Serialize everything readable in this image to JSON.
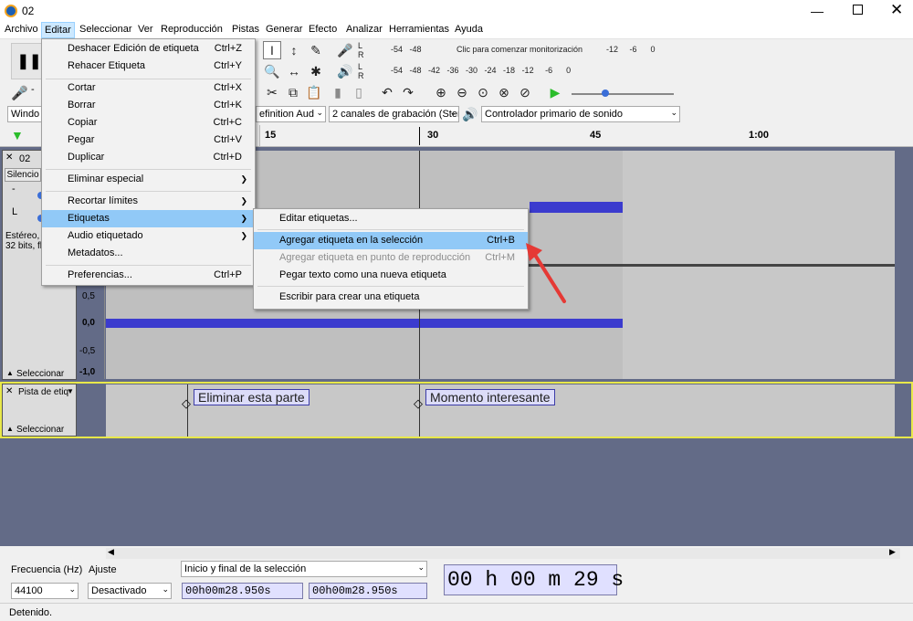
{
  "window": {
    "title": "02"
  },
  "menubar": [
    "Archivo",
    "Editar",
    "Seleccionar",
    "Ver",
    "Reproducción",
    "Pistas",
    "Generar",
    "Efecto",
    "Analizar",
    "Herramientas",
    "Ayuda"
  ],
  "meters": {
    "rec_scale": "-54   -48   ",
    "rec_prompt": "Clic para comenzar monitorización",
    "rec_scale_end": "-12     -6      0",
    "play_scale": "-54   -48   -42   -36   -30   -24   -18   -12     -6      0",
    "L": "L",
    "R": "R"
  },
  "devices": {
    "host": "Windo",
    "input": "efinition Aud",
    "channels": "2 canales de grabación (Ster",
    "output": "Controlador primario de sonido"
  },
  "ruler": {
    "t15": "15",
    "t30": "30",
    "t45": "45",
    "t100": "1:00"
  },
  "track1": {
    "name": "02",
    "mute": "Silencio",
    "info": "Estéreo, 4",
    "info2": "32 bits, flo",
    "select": "Seleccionar",
    "scale": [
      "0,5",
      "0,0",
      "-0,5",
      "-1,0"
    ],
    "L": "L",
    "minus": "-"
  },
  "track2": {
    "name": "Pista de etiq",
    "select": "Seleccionar",
    "labels": [
      "Eliminar esta parte",
      "Momento interesante"
    ]
  },
  "edit_menu": [
    {
      "label": "Deshacer Edición de etiqueta",
      "shortcut": "Ctrl+Z"
    },
    {
      "label": "Rehacer Etiqueta",
      "shortcut": "Ctrl+Y"
    },
    {
      "label": "Cortar",
      "shortcut": "Ctrl+X"
    },
    {
      "label": "Borrar",
      "shortcut": "Ctrl+K"
    },
    {
      "label": "Copiar",
      "shortcut": "Ctrl+C"
    },
    {
      "label": "Pegar",
      "shortcut": "Ctrl+V"
    },
    {
      "label": "Duplicar",
      "shortcut": "Ctrl+D"
    },
    {
      "label": "Eliminar especial",
      "shortcut": ""
    },
    {
      "label": "Recortar límites",
      "shortcut": ""
    },
    {
      "label": "Etiquetas",
      "shortcut": ""
    },
    {
      "label": "Audio etiquetado",
      "shortcut": ""
    },
    {
      "label": "Metadatos...",
      "shortcut": ""
    },
    {
      "label": "Preferencias...",
      "shortcut": "Ctrl+P"
    }
  ],
  "labels_menu": [
    {
      "label": "Editar etiquetas...",
      "shortcut": ""
    },
    {
      "label": "Agregar etiqueta en la selección",
      "shortcut": "Ctrl+B"
    },
    {
      "label": "Agregar etiqueta en punto de reproducción",
      "shortcut": "Ctrl+M"
    },
    {
      "label": "Pegar texto como una nueva etiqueta",
      "shortcut": ""
    },
    {
      "label": "Escribir para crear una etiqueta",
      "shortcut": ""
    }
  ],
  "bottom": {
    "rate_label": "Frecuencia (Hz)",
    "rate_value": "44100",
    "snap_label": "Ajuste",
    "snap_value": "Desactivado",
    "sel_mode": "Inicio y final de la selección",
    "sel_start": "00h00m28.950s",
    "sel_end": "00h00m28.950s",
    "time": "00 h 00 m 29 s",
    "status": "Detenido."
  },
  "colors": {
    "waveform": "#3b3bce",
    "highlight": "#91c9f7",
    "arrow": "#e53935"
  }
}
